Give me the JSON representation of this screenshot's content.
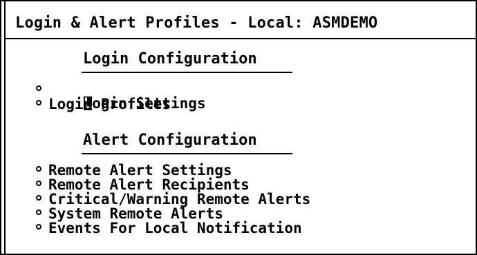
{
  "window": {
    "title": "Login & Alert Profiles - Local: ASMDEMO"
  },
  "sections": [
    {
      "heading": "Login Configuration",
      "items": [
        {
          "label": "Login Settings",
          "selected": true
        },
        {
          "label": "Login Profiles",
          "selected": false
        }
      ]
    },
    {
      "heading": "Alert Configuration",
      "items": [
        {
          "label": "Remote Alert Settings",
          "selected": false
        },
        {
          "label": "Remote Alert Recipients",
          "selected": false
        },
        {
          "label": "Critical/Warning Remote Alerts",
          "selected": false
        },
        {
          "label": "System Remote Alerts",
          "selected": false
        },
        {
          "label": "Events For Local Notification",
          "selected": false
        }
      ]
    }
  ],
  "colors": {
    "background": "#ffffff",
    "foreground": "#000000"
  }
}
